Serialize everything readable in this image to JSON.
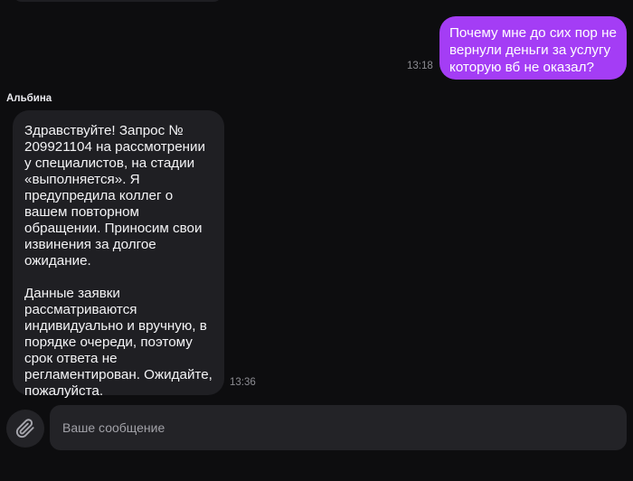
{
  "chat": {
    "outgoing": {
      "text": "Почему мне до сих пор не вернули деньги за услугу которую вб не оказал?",
      "time": "13:18"
    },
    "incoming": {
      "sender": "Альбина",
      "paragraph_1": "Здравствуйте! Запрос №\n209921104 на рассмотрении\nу специалистов, на стадии\n«выполняется». Я\nпредупредила коллег о\nвашем повторном\nобращении. Приносим свои\nизвинения за долгое\nожидание.",
      "paragraph_2": "Данные заявки\nрассматриваются\nиндивидуально и вручную, в\nпорядке очереди, поэтому\nсрок ответа не\nрегламентирован. Ожидайте,\nпожалуйста.",
      "time": "13:36"
    }
  },
  "composer": {
    "placeholder": "Ваше сообщение",
    "value": "",
    "attach_icon": "paperclip-icon"
  },
  "colors": {
    "background": "#0d0d0f",
    "outgoing_bubble": "#a43df5",
    "incoming_bubble": "#1f1f23",
    "input_background": "#232327",
    "timestamp": "#8c8c92"
  }
}
